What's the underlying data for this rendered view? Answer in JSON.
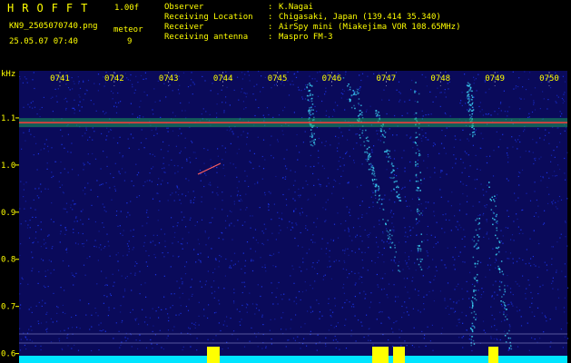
{
  "header": {
    "app_title": "HROFFT",
    "version": "1.00f",
    "filename": "KN9_2505070740.png",
    "meteor_label": "meteor",
    "meteor_count": "9",
    "datetime": "25.05.07 07:40"
  },
  "metadata": [
    {
      "key": "Observer",
      "sep": ":",
      "value": "K.Nagai"
    },
    {
      "key": "Receiving Location",
      "sep": ":",
      "value": "Chigasaki, Japan (139.414 35.340)"
    },
    {
      "key": "Receiver",
      "sep": ":",
      "value": "AirSpy mini (Miakejima VOR 108.65MHz)"
    },
    {
      "key": "Receiving antenna",
      "sep": ":",
      "value": "Maspro FM-3"
    }
  ],
  "chart_data": {
    "type": "heatmap",
    "ylabel": "kHz",
    "x_tick_labels": [
      "0741",
      "0742",
      "0743",
      "0744",
      "0745",
      "0746",
      "0747",
      "0748",
      "0749",
      "0750"
    ],
    "y_tick_labels": [
      "1.1",
      "1.0",
      "0.9",
      "0.8",
      "0.7",
      "0.6"
    ],
    "y_ticks": [
      1.1,
      1.0,
      0.9,
      0.8,
      0.7,
      0.6
    ],
    "ylim": [
      0.58,
      1.2
    ],
    "carrier_khz": 1.09,
    "colors": {
      "background": "#0a0a5a",
      "noise": "#1e3cff",
      "carrier": "#ff3b3b",
      "echo": "#3fe0ff",
      "baseline": "#00e5ff",
      "burst": "#ffff00",
      "text": "#ffff00"
    }
  }
}
